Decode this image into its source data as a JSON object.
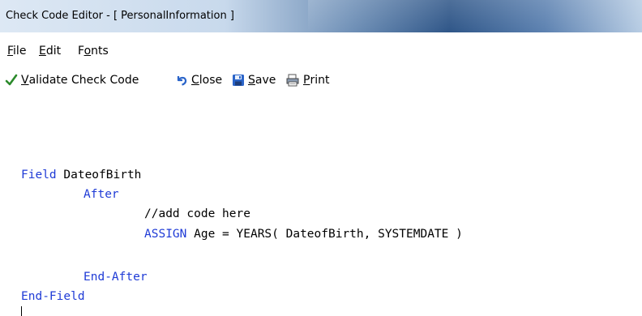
{
  "window": {
    "title": "Check Code Editor - [ PersonalInformation ]"
  },
  "menu": {
    "items": [
      {
        "label_u": "F",
        "label_rest": "ile"
      },
      {
        "label_u": "E",
        "label_rest": "dit"
      },
      {
        "label_pre": "F",
        "label_u": "o",
        "label_rest": "nts"
      }
    ]
  },
  "toolbar": {
    "validate": {
      "u": "V",
      "rest": "alidate Check Code",
      "icon": "checkmark-icon"
    },
    "close": {
      "u": "C",
      "rest": "lose",
      "icon": "undo-icon"
    },
    "save": {
      "u": "S",
      "rest": "ave",
      "icon": "floppy-disk-icon"
    },
    "print": {
      "u": "P",
      "rest": "rint",
      "icon": "printer-icon"
    }
  },
  "editor": {
    "lines": {
      "l1_kw": "Field",
      "l1_rest": " DateofBirth",
      "l2": "After",
      "l3": "//add code here",
      "l4_kw": "ASSIGN",
      "l4_rest": " Age = YEARS( DateofBirth, SYSTEMDATE )",
      "l5": "End-After",
      "l6": "End-Field"
    }
  },
  "colors": {
    "keyword": "#1f3bd6",
    "check_green": "#2b8a2b",
    "save_blue": "#2a64c9"
  }
}
